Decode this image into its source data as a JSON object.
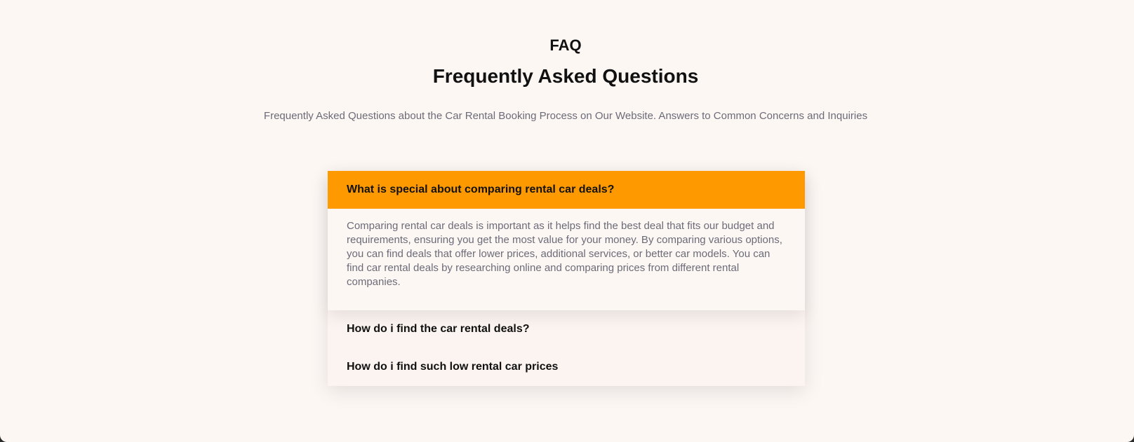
{
  "section": {
    "eyebrow": "FAQ",
    "title": "Frequently Asked Questions",
    "subtitle": "Frequently Asked Questions about the Car Rental Booking Process on Our Website. Answers to Common Concerns and Inquiries"
  },
  "colors": {
    "accent": "#ff9900",
    "background": "#fdf7f4",
    "muted_text": "#6b6b78"
  },
  "faq": {
    "items": [
      {
        "question": "What is special about comparing rental car deals?",
        "answer": "Comparing rental car deals is important as it helps find the best deal that fits our budget and requirements, ensuring you get the most value for your money. By comparing various options, you can find deals that offer lower prices, additional services, or better car models. You can find car rental deals by researching online and comparing prices from different rental companies.",
        "expanded": true
      },
      {
        "question": "How do i find the car rental deals?",
        "expanded": false
      },
      {
        "question": "How do i find such low rental car prices",
        "expanded": false
      }
    ]
  }
}
